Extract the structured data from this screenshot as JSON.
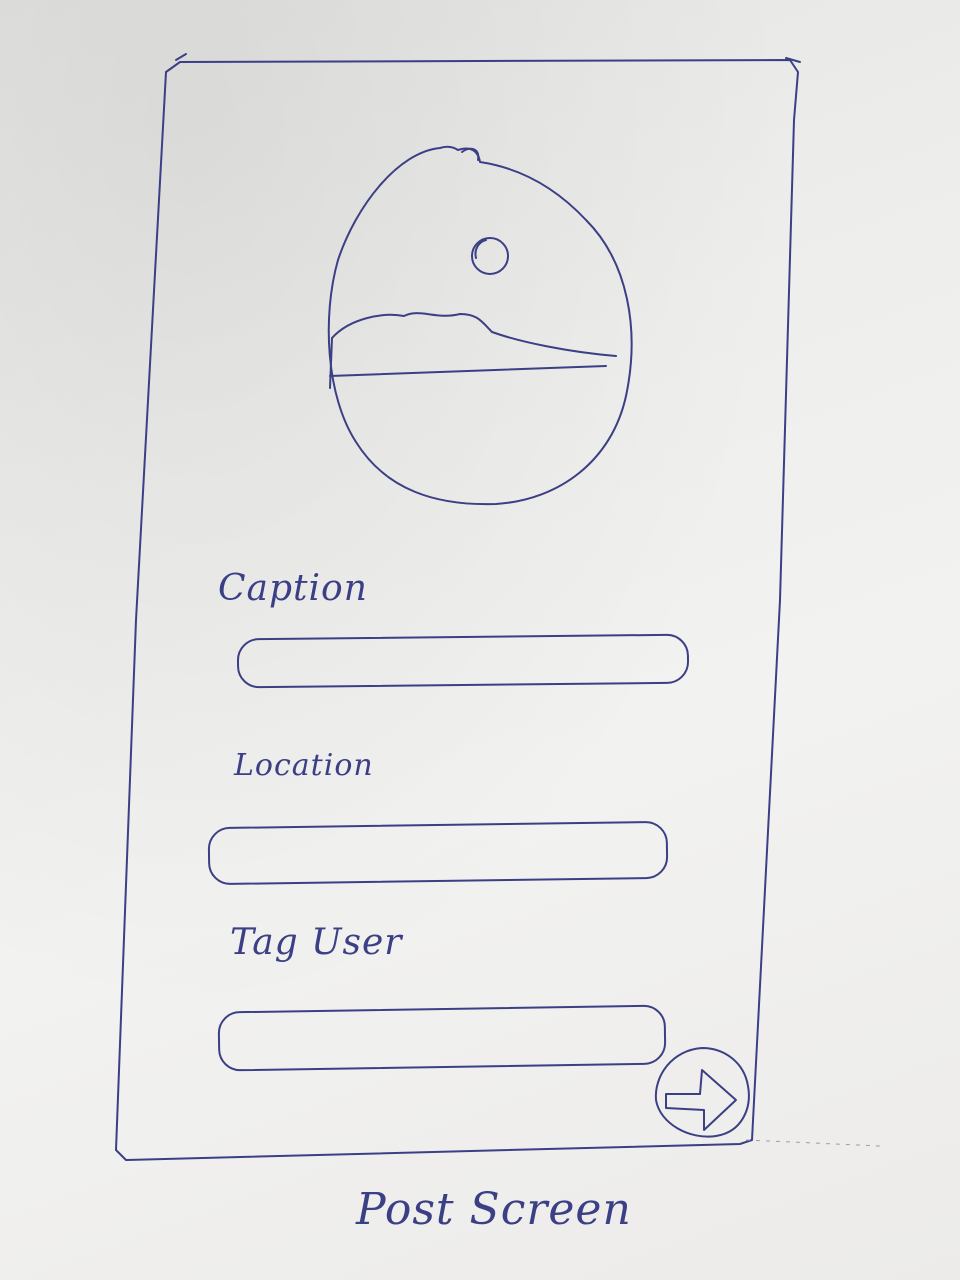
{
  "screen": {
    "title": "Post Screen"
  },
  "form": {
    "caption_label": "Caption",
    "location_label": "Location",
    "tag_label": "Tag User"
  },
  "icons": {
    "image": "image-placeholder-icon",
    "submit": "arrow-right-icon"
  },
  "colors": {
    "ink": "#3b3f85",
    "paper": "#eeeeec"
  }
}
